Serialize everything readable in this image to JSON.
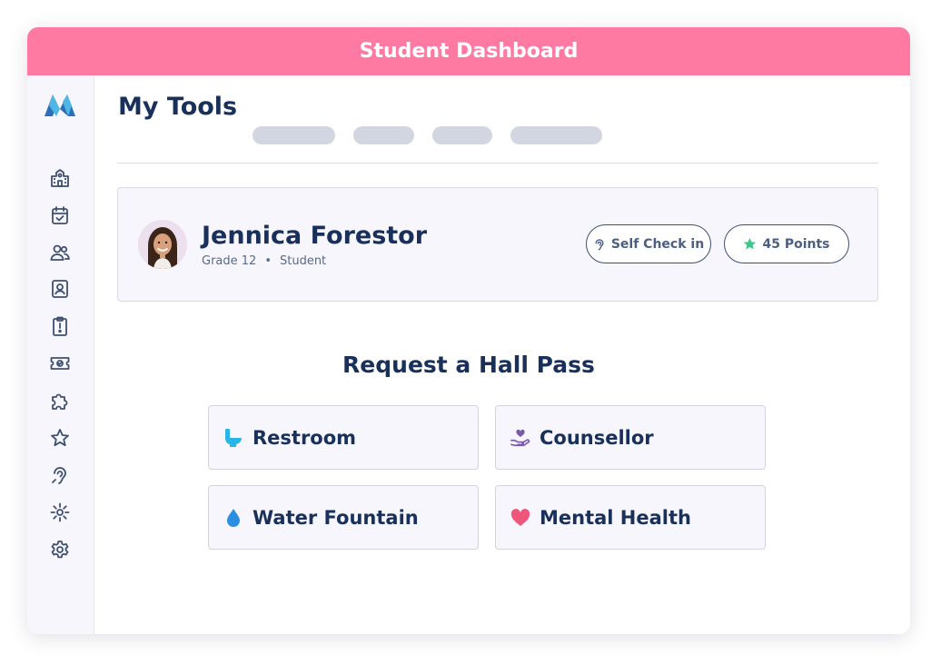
{
  "window": {
    "title": "Student Dashboard"
  },
  "sidebar": {
    "logo": "brand-m-logo",
    "items": [
      {
        "name": "school-icon"
      },
      {
        "name": "calendar-check-icon"
      },
      {
        "name": "users-icon"
      },
      {
        "name": "contact-card-icon"
      },
      {
        "name": "clipboard-icon"
      },
      {
        "name": "ticket-icon"
      },
      {
        "name": "puzzle-icon"
      },
      {
        "name": "star-icon"
      },
      {
        "name": "ear-icon"
      },
      {
        "name": "burst-icon"
      },
      {
        "name": "gear-icon"
      }
    ]
  },
  "main": {
    "title": "My Tools"
  },
  "profile": {
    "name": "Jennica Forestor",
    "grade": "Grade 12",
    "separator": "•",
    "role": "Student",
    "self_check_label": "Self Check in",
    "points_label": "45 Points"
  },
  "hall_pass": {
    "title": "Request a Hall Pass",
    "options": [
      {
        "label": "Restroom",
        "icon": "toilet-icon",
        "color": "#29b6e6"
      },
      {
        "label": "Counsellor",
        "icon": "heart-hand-icon",
        "color": "#7a5aa8"
      },
      {
        "label": "Water Fountain",
        "icon": "water-drop-icon",
        "color": "#2a8fe0"
      },
      {
        "label": "Mental Health",
        "icon": "heart-icon",
        "color": "#f0557a"
      }
    ]
  },
  "colors": {
    "header": "#ff7aa2",
    "navy": "#18305a",
    "star": "#3fc48a"
  }
}
